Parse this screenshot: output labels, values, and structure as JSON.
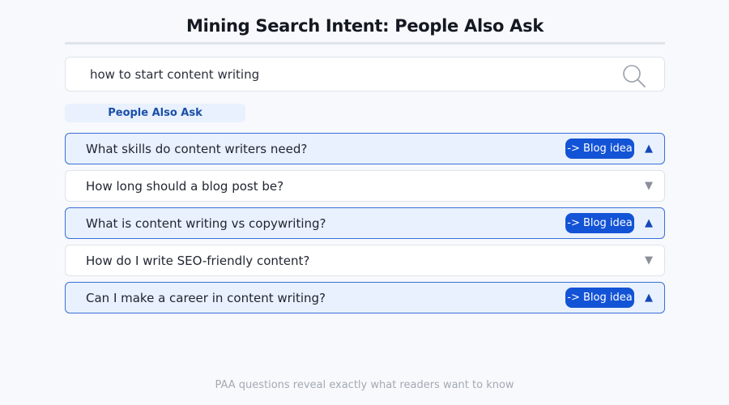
{
  "header": {
    "title": "Mining Search Intent: People Also Ask"
  },
  "search": {
    "value": "how to start content writing",
    "icon": "search-icon"
  },
  "paa": {
    "label": "People Also Ask",
    "items": [
      {
        "question": "What skills do content writers need?",
        "expanded": true,
        "badge": "-> Blog idea",
        "caret": "▲"
      },
      {
        "question": "How long should a blog post be?",
        "expanded": false,
        "badge": "",
        "caret": "▼"
      },
      {
        "question": "What is content writing vs copywriting?",
        "expanded": true,
        "badge": "-> Blog idea",
        "caret": "▲"
      },
      {
        "question": "How do I write SEO-friendly content?",
        "expanded": false,
        "badge": "",
        "caret": "▼"
      },
      {
        "question": "Can I make a career in content writing?",
        "expanded": true,
        "badge": "-> Blog idea",
        "caret": "▲"
      }
    ]
  },
  "footer": {
    "note": "PAA questions reveal exactly what readers want to know"
  },
  "colors": {
    "accent": "#1353d6",
    "expanded_bg": "#e8f1fd",
    "expanded_border": "#3a6fd8"
  }
}
